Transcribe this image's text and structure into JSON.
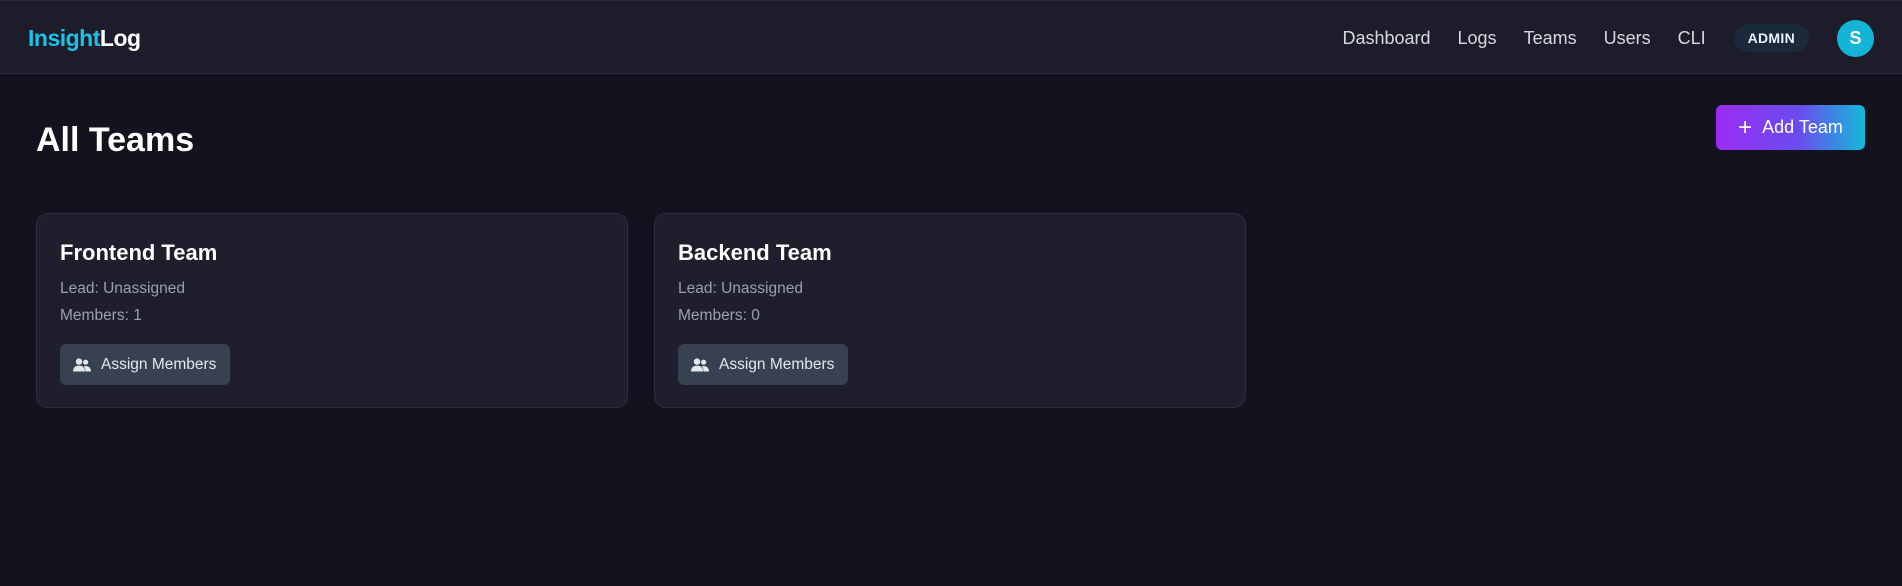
{
  "app": {
    "brand_part1": "Insight",
    "brand_part2": "Log"
  },
  "nav": {
    "items": [
      {
        "label": "Dashboard"
      },
      {
        "label": "Logs"
      },
      {
        "label": "Teams"
      },
      {
        "label": "Users"
      },
      {
        "label": "CLI"
      }
    ],
    "role_badge": "ADMIN",
    "avatar_initial": "S"
  },
  "page": {
    "title": "All Teams",
    "add_button": {
      "icon": "plus-icon",
      "label": "Add Team"
    }
  },
  "teams": [
    {
      "name": "Frontend Team",
      "lead": "Lead: Unassigned",
      "members": "Members: 1",
      "assign_label": "Assign Members",
      "assign_icon": "users-icon"
    },
    {
      "name": "Backend Team",
      "lead": "Lead: Unassigned",
      "members": "Members: 0",
      "assign_label": "Assign Members",
      "assign_icon": "users-icon"
    }
  ],
  "colors": {
    "background": "#13131f",
    "topbar": "#1c1c2a",
    "card": "#1e1e2d",
    "accent_cyan": "#19c3e6",
    "accent_purple": "#9b2cf2",
    "button_gray": "#374151"
  }
}
